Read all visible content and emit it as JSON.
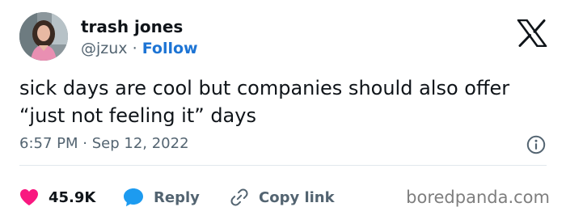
{
  "author": {
    "name": "trash jones",
    "handle": "@jzux",
    "separator": "·",
    "follow_label": "Follow"
  },
  "tweet": {
    "text_lines": [
      "sick days are cool but companies should also offer",
      "“just not feeling it” days"
    ],
    "time": "6:57 PM",
    "date_separator": "·",
    "date": "Sep 12, 2022"
  },
  "actions": {
    "likes_count": "45.9K",
    "reply_label": "Reply",
    "copy_link_label": "Copy link"
  },
  "icons": {
    "logo": "x-logo-icon",
    "info": "info-icon",
    "like": "heart-icon",
    "reply": "speech-bubble-icon",
    "copy": "link-icon"
  },
  "colors": {
    "follow": "#1d74d4",
    "like": "#f91880",
    "reply": "#1d9bf0",
    "text": "#0f1419",
    "muted": "#536471"
  },
  "watermark": "boredpanda.com"
}
